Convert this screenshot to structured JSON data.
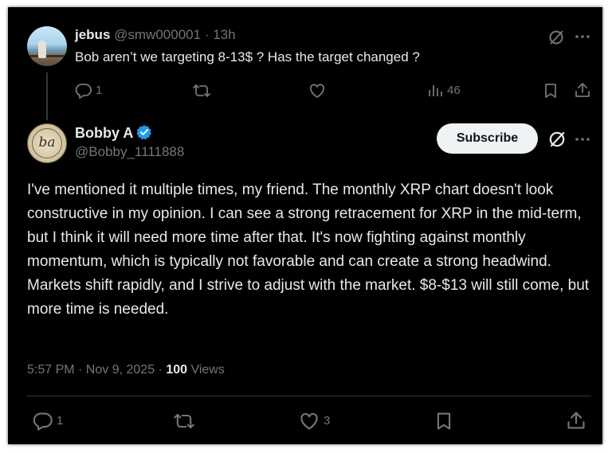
{
  "reply": {
    "author_name": "jebus",
    "handle": "@smw000001",
    "separator": "·",
    "time": "13h",
    "text": "Bob aren’t we targeting 8-13$ ?  Has the target changed ?",
    "reply_count": "1",
    "view_count": "46",
    "avatar": "jebus-avatar-photo"
  },
  "post": {
    "author_name": "Bobby A",
    "handle": "@Bobby_1111888",
    "verified": true,
    "subscribe_label": "Subscribe",
    "avatar_text": "ba",
    "text": "I've mentioned it multiple times, my friend. The monthly XRP chart doesn't look constructive in my opinion. I can see a strong retracement for XRP in the mid-term, but I think it will need more time after that. It's now fighting against monthly momentum, which is typically not favorable and can create a strong headwind. Markets shift rapidly, and I strive to adjust with the market. $8-$13 will still come, but more time is needed.",
    "timestamp": "5:57 PM · Nov 9, 2025 · ",
    "views_count": "100",
    "views_label": " Views",
    "reply_count": "1",
    "like_count": "3"
  },
  "colors": {
    "background": "#000000",
    "text_primary": "#e7e9ea",
    "text_muted": "#71767b",
    "verified_blue": "#1d9bf0",
    "subscribe_bg": "#eff3f4"
  },
  "icons": [
    "grok-icon",
    "more-icon",
    "reply-icon",
    "retweet-icon",
    "like-icon",
    "views-icon",
    "bookmark-icon",
    "share-icon",
    "verified-badge-icon"
  ]
}
